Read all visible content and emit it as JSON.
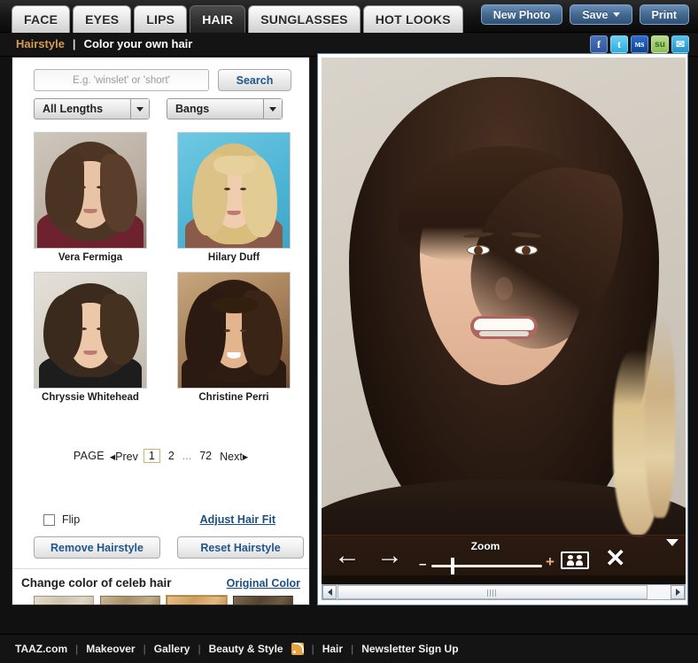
{
  "header": {
    "tabs": [
      {
        "label": "FACE",
        "active": false
      },
      {
        "label": "EYES",
        "active": false
      },
      {
        "label": "LIPS",
        "active": false
      },
      {
        "label": "HAIR",
        "active": true
      },
      {
        "label": "SUNGLASSES",
        "active": false
      },
      {
        "label": "HOT LOOKS",
        "active": false
      }
    ],
    "buttons": [
      {
        "label": "New Photo",
        "caret": false
      },
      {
        "label": "Save",
        "caret": true
      },
      {
        "label": "Print",
        "caret": false
      }
    ]
  },
  "subheader": {
    "active_crumb": "Hairstyle",
    "separator": "|",
    "text": "Color your own hair",
    "social": [
      {
        "name": "facebook-icon",
        "glyph": "f"
      },
      {
        "name": "twitter-icon",
        "glyph": "t"
      },
      {
        "name": "myspace-icon",
        "glyph": "ᴍѕ"
      },
      {
        "name": "stumbleupon-icon",
        "glyph": "su"
      },
      {
        "name": "email-icon",
        "glyph": "✉"
      }
    ]
  },
  "left_panel": {
    "search": {
      "placeholder": "E.g. 'winslet' or 'short'",
      "value": "",
      "button_label": "Search"
    },
    "filters": [
      {
        "name": "length-select",
        "value": "All Lengths"
      },
      {
        "name": "bangs-select",
        "value": "Bangs"
      }
    ],
    "thumbnails": [
      {
        "name": "Vera Fermiga"
      },
      {
        "name": "Hilary Duff"
      },
      {
        "name": "Chryssie Whitehead"
      },
      {
        "name": "Christine Perri"
      }
    ],
    "pagination": {
      "label": "PAGE",
      "prev": "◂Prev",
      "pages": [
        "1",
        "2"
      ],
      "current": "1",
      "dots": "...",
      "last": "72",
      "next": "Next▸"
    },
    "flip": {
      "label": "Flip",
      "checked": false
    },
    "adjust_link": "Adjust Hair Fit",
    "actions": [
      {
        "label": "Remove Hairstyle"
      },
      {
        "label": "Reset Hairstyle"
      }
    ],
    "color_section": {
      "title": "Change color of celeb hair",
      "original_link": "Original Color",
      "swatches": [
        {
          "color": "#d8cfbd",
          "selected": false
        },
        {
          "color": "#b9a382",
          "selected": false
        },
        {
          "color": "#e0b177",
          "selected": true
        },
        {
          "color": "#6f5a44",
          "selected": false
        },
        {
          "color": "#8a4c33",
          "selected": false
        },
        {
          "color": "#b2521f",
          "selected": false
        },
        {
          "color": "#4e3526",
          "selected": false
        },
        {
          "color": "#8d3b30",
          "selected": false
        }
      ],
      "prev_arrow": "prev-colors-arrow",
      "next_arrow": "next-colors-arrow"
    }
  },
  "image_toolbar": {
    "back": "←",
    "forward": "→",
    "zoom_label": "Zoom",
    "zoom_minus": "–",
    "zoom_plus": "+",
    "zoom_value": 18,
    "compare_icon": "compare-before-after-icon",
    "close": "✕",
    "collapse_icon": "collapse-toolbar-chevron"
  },
  "footer": {
    "links": [
      {
        "label": "TAAZ.com"
      },
      {
        "label": "Makeover"
      },
      {
        "label": "Gallery"
      },
      {
        "label": "Beauty & Style"
      },
      {
        "label": "Hair"
      },
      {
        "label": "Newsletter Sign Up"
      }
    ],
    "separator": "|",
    "rss_icon": "rss-feed-icon"
  }
}
